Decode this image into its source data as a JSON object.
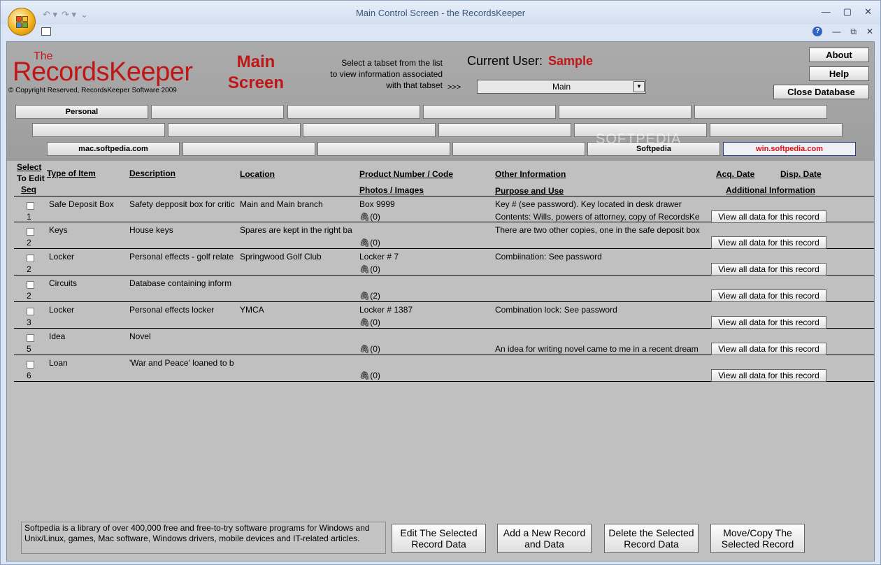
{
  "window": {
    "title": "Main Control Screen - the RecordsKeeper",
    "qat_undo": "↶ ▾",
    "qat_redo": "↷ ▾",
    "qat_more": "⌄",
    "btn_min": "—",
    "btn_max": "▢",
    "btn_close": "✕",
    "ribbon_help": "?",
    "ribbon_min": "—",
    "ribbon_restore": "⧉",
    "ribbon_close": "✕"
  },
  "header": {
    "logo_the": "The",
    "logo_name": "RecordsKeeper",
    "copyright": "© Copyright Reserved, RecordsKeeper Software  2009",
    "main_screen": "Main Screen",
    "instructions_line1": "Select a tabset from the list",
    "instructions_line2": "to view information associated",
    "instructions_line3": "with that tabset",
    "arrows": ">>>",
    "current_user_label": "Current User:",
    "current_user_value": "Sample",
    "tabset_selected": "Main",
    "about_button": "About",
    "help_button": "Help",
    "close_database_button": "Close Database",
    "watermark": "SOFTPEDIA"
  },
  "tabs": {
    "row1": [
      "Personal",
      "",
      "",
      "",
      "",
      ""
    ],
    "row2": [
      "",
      "",
      "",
      "",
      "",
      ""
    ],
    "row3": [
      "mac.softpedia.com",
      "",
      "",
      "",
      "Softpedia",
      "win.softpedia.com"
    ]
  },
  "columns": {
    "select": "Select",
    "to_edit": "To Edit",
    "seq": "Seq",
    "type": "Type of Item",
    "description": "Description",
    "location": "Location",
    "product": "Product Number / Code",
    "photos": "Photos / Images",
    "other": "Other Information",
    "purpose": "Purpose and Use",
    "acq_date": "Acq. Date",
    "disp_date": "Disp. Date",
    "additional": "Additional Information"
  },
  "records": [
    {
      "seq": "1",
      "type": "Safe Deposit Box",
      "description": "Safety depposit box for critic",
      "location": "Main and Main branch",
      "product": "Box 9999",
      "photos": "(0)",
      "other": "Key # (see password). Key located in desk drawer",
      "purpose": "Contents: Wills, powers of attorney, copy of RecordsKe",
      "view": "View all data for this record"
    },
    {
      "seq": "2",
      "type": "Keys",
      "description": "House keys",
      "location": "Spares are kept in the right ba",
      "product": "",
      "photos": "(0)",
      "other": "There are two other copies, one in the safe deposit box",
      "purpose": "",
      "view": "View all data for this record"
    },
    {
      "seq": "2",
      "type": "Locker",
      "description": "Personal effects - golf relate",
      "location": "Springwood Golf Club",
      "product": "Locker # 7",
      "photos": "(0)",
      "other": "Combiination: See password",
      "purpose": "",
      "view": "View all data for this record"
    },
    {
      "seq": "2",
      "type": "Circuits",
      "description": "Database containing inform",
      "location": "",
      "product": "",
      "photos": "(2)",
      "other": "",
      "purpose": "",
      "view": "View all data for this record"
    },
    {
      "seq": "3",
      "type": "Locker",
      "description": "Personal effects locker",
      "location": "YMCA",
      "product": "Locker # 1387",
      "photos": "(0)",
      "other": "Combination lock: See password",
      "purpose": "",
      "view": "View all data for this record"
    },
    {
      "seq": "5",
      "type": "Idea",
      "description": "Novel",
      "location": "",
      "product": "",
      "photos": "(0)",
      "other": "",
      "purpose": "An idea for writing novel came to me in a recent dream",
      "view": "View all data for this record"
    },
    {
      "seq": "6",
      "type": "Loan",
      "description": "'War and Peace' loaned to b",
      "location": "",
      "product": "",
      "photos": "(0)",
      "other": "",
      "purpose": "",
      "view": "View all data for this record"
    }
  ],
  "footer": {
    "description": "Softpedia is a library of over 400,000 free and free-to-try software programs for Windows and Unix/Linux, games, Mac software, Windows drivers, mobile devices and IT-related articles.",
    "edit_line1": "Edit The Selected",
    "edit_line2": "Record Data",
    "add_line1": "Add a New Record",
    "add_line2": "and Data",
    "delete_line1": "Delete the Selected",
    "delete_line2": "Record Data",
    "move_line1": "Move/Copy The",
    "move_line2": "Selected Record"
  },
  "colors": {
    "accent_red": "#c01616",
    "tab_selected_text": "#e01010",
    "form_bg": "#c0c0c0"
  }
}
